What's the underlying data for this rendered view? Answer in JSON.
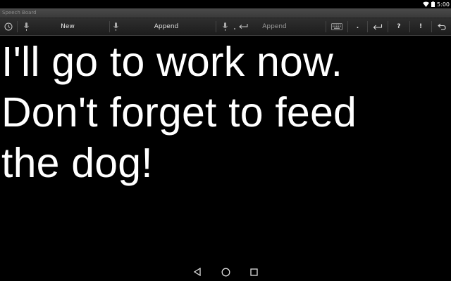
{
  "status_bar": {
    "time": "5:00"
  },
  "title_bar": {
    "title": "Speech Board"
  },
  "toolbar": {
    "new_label": "New",
    "append_label": "Append",
    "append_newline_label": "Append",
    "period_label": ".",
    "question_label": "?",
    "exclaim_label": "!"
  },
  "content": {
    "text": "I'll go to work now.\nDon't forget to feed\nthe dog!"
  }
}
